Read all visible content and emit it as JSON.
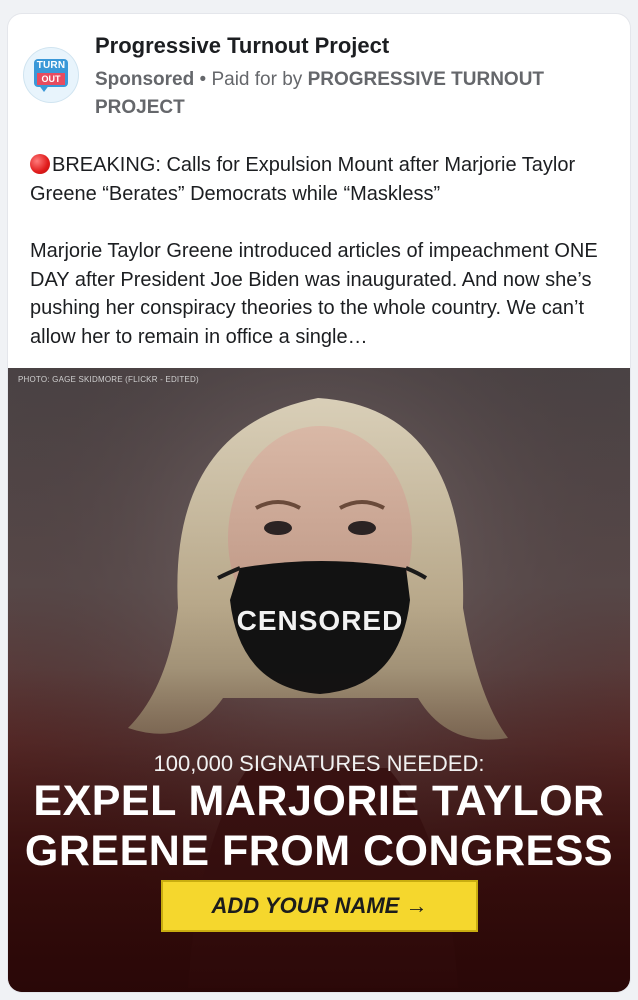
{
  "post": {
    "page_name": "Progressive Turnout Project",
    "avatar_line1": "TURN",
    "avatar_line2": "OUT",
    "sponsored": "Sponsored",
    "separator": "•",
    "paid_for_prefix": "Paid for by",
    "paid_for_by": "PROGRESSIVE TURNOUT PROJECT",
    "paragraph1": "BREAKING: Calls for Expulsion Mount after Marjorie Taylor Greene “Berates” Democrats while “Maskless”",
    "paragraph2": "Marjorie Taylor Greene introduced articles of impeachment ONE DAY after President Joe Biden was inaugurated. And now she’s pushing her conspiracy theories to the whole country. We can’t allow her to remain in office a single…"
  },
  "ad_image": {
    "photo_credit": "PHOTO: GAGE SKIDMORE (FLICKR - EDITED)",
    "mask_text": "CENSORED",
    "signatures": "100,000 SIGNATURES NEEDED:",
    "headline_line1": "EXPEL MARJORIE TAYLOR",
    "headline_line2": "GREENE FROM CONGRESS",
    "cta_label": "ADD YOUR NAME →"
  },
  "colors": {
    "cta_background": "#f5d72d",
    "avatar_blue": "#3a98d8",
    "avatar_red": "#e84b5f",
    "breaking_dot": "#e01b1b"
  },
  "icons": [
    "red-circle-icon"
  ]
}
